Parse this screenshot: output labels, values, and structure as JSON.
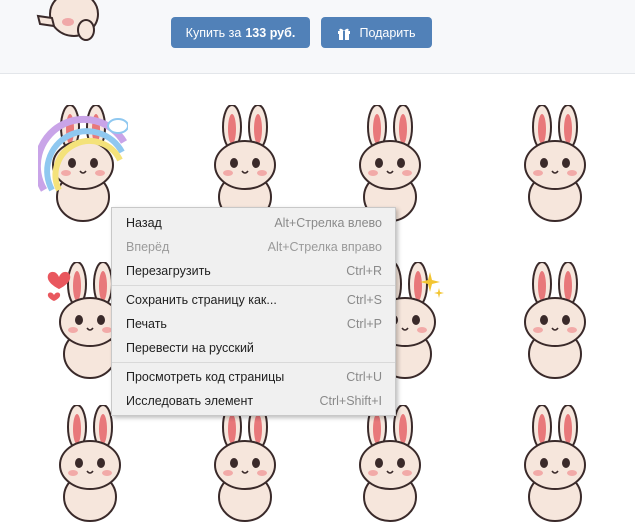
{
  "header": {
    "buy_label": "Купить за",
    "buy_price": "133 руб.",
    "gift_label": "Подарить"
  },
  "context_menu": {
    "items": [
      {
        "label": "Назад",
        "shortcut": "Alt+Стрелка влево",
        "enabled": true
      },
      {
        "label": "Вперёд",
        "shortcut": "Alt+Стрелка вправо",
        "enabled": false
      },
      {
        "label": "Перезагрузить",
        "shortcut": "Ctrl+R",
        "enabled": true
      },
      {
        "label": "Сохранить страницу как...",
        "shortcut": "Ctrl+S",
        "enabled": true
      },
      {
        "label": "Печать",
        "shortcut": "Ctrl+P",
        "enabled": true
      },
      {
        "label": "Перевести на русский",
        "shortcut": "",
        "enabled": true
      },
      {
        "label": "Просмотреть код страницы",
        "shortcut": "Ctrl+U",
        "enabled": true
      },
      {
        "label": "Исследовать элемент",
        "shortcut": "Ctrl+Shift+I",
        "enabled": true
      }
    ]
  },
  "colors": {
    "accent": "#5181b8",
    "bunny_body": "#f6e6dc",
    "bunny_ear_inner": "#e8787a",
    "bunny_outline": "#3a2a2a"
  },
  "stickers": {
    "count_visible": 13,
    "icon": "bunny-sticker"
  }
}
